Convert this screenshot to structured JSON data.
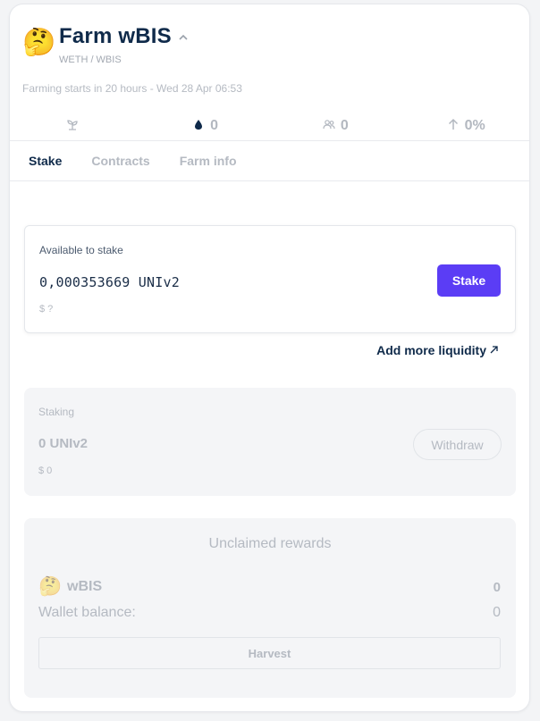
{
  "header": {
    "emoji": "🤔",
    "title": "Farm wBIS",
    "pair": "WETH / WBIS",
    "starts": "Farming starts in 20 hours - Wed 28 Apr 06:53"
  },
  "stats": [
    {
      "icon": "sprout-icon",
      "value": ""
    },
    {
      "icon": "drop-icon",
      "value": "0"
    },
    {
      "icon": "users-icon",
      "value": "0"
    },
    {
      "icon": "arrow-up-icon",
      "value": "0%"
    }
  ],
  "tabs": [
    {
      "label": "Stake",
      "active": true
    },
    {
      "label": "Contracts",
      "active": false
    },
    {
      "label": "Farm info",
      "active": false
    }
  ],
  "available": {
    "label": "Available to stake",
    "amount": "0,000353669 UNIv2",
    "usd": "$ ?",
    "button": "Stake"
  },
  "add_liquidity": {
    "label": "Add more liquidity",
    "icon": "external-arrow-icon"
  },
  "staking": {
    "label": "Staking",
    "amount": "0 UNIv2",
    "usd": "$ 0",
    "button": "Withdraw"
  },
  "rewards": {
    "heading": "Unclaimed rewards",
    "token_emoji": "🤔",
    "token_name": "wBIS",
    "token_value": "0",
    "wallet_label": "Wallet balance:",
    "wallet_value": "0",
    "button": "Harvest"
  },
  "colors": {
    "accent": "#5b3df5",
    "title": "#0f2a4a",
    "muted": "#b5bac2"
  }
}
